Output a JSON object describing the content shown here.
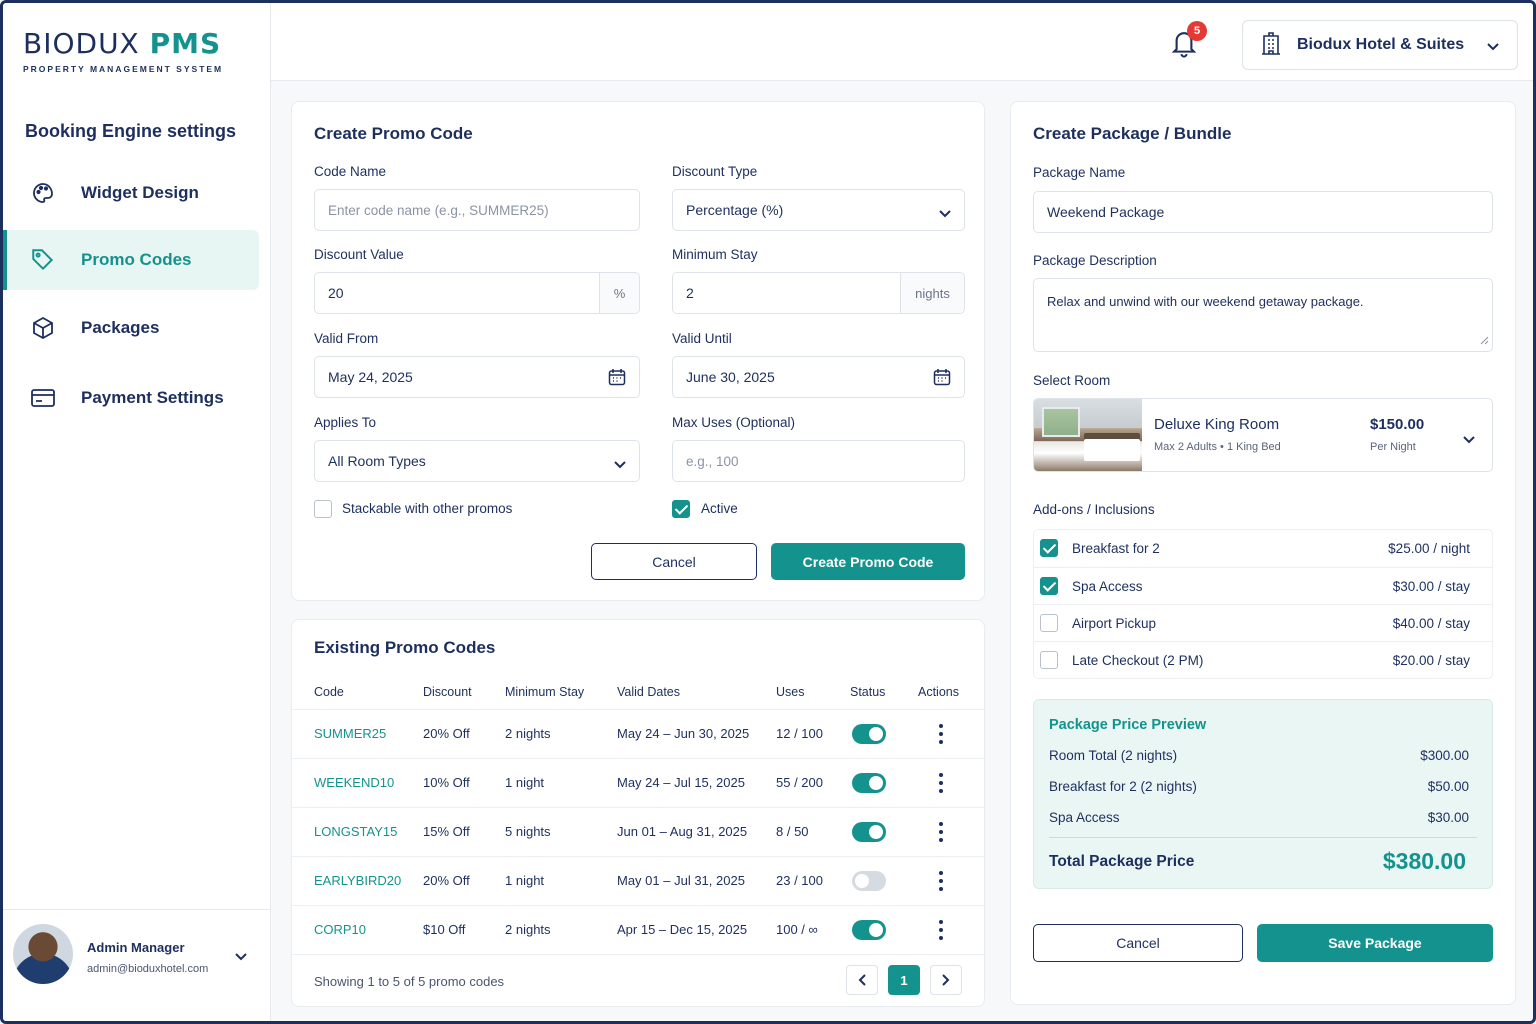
{
  "brand": {
    "name_part1": "BIODUX",
    "name_part2": "PMS",
    "tagline": "PROPERTY MANAGEMENT SYSTEM"
  },
  "sidebar": {
    "title": "Booking Engine settings",
    "items": [
      {
        "label": "Widget Design",
        "icon": "palette-icon"
      },
      {
        "label": "Promo Codes",
        "icon": "tag-icon",
        "active": true
      },
      {
        "label": "Packages",
        "icon": "box-icon"
      },
      {
        "label": "Payment Settings",
        "icon": "card-icon"
      }
    ],
    "user": {
      "name": "Admin Manager",
      "email": "admin@bioduxhotel.com"
    }
  },
  "topbar": {
    "notification_count": "5",
    "hotel_name": "Biodux Hotel & Suites"
  },
  "promo_form": {
    "title": "Create Promo Code",
    "code_name_label": "Code Name",
    "code_name_placeholder": "Enter code name (e.g., SUMMER25)",
    "discount_type_label": "Discount Type",
    "discount_type_value": "Percentage (%)",
    "discount_value_label": "Discount Value",
    "discount_value": "20",
    "discount_value_suffix": "%",
    "min_stay_label": "Minimum Stay",
    "min_stay_value": "2",
    "min_stay_suffix": "nights",
    "valid_from_label": "Valid From",
    "valid_from_value": "May 24, 2025",
    "valid_until_label": "Valid Until",
    "valid_until_value": "June 30, 2025",
    "applies_to_label": "Applies To",
    "applies_to_value": "All Room Types",
    "max_uses_label": "Max Uses (Optional)",
    "max_uses_placeholder": "e.g., 100",
    "stackable_label": "Stackable with other promos",
    "stackable_checked": false,
    "active_label": "Active",
    "active_checked": true,
    "cancel_label": "Cancel",
    "submit_label": "Create Promo Code"
  },
  "promo_table": {
    "title": "Existing Promo Codes",
    "columns": [
      "Code",
      "Discount",
      "Minimum Stay",
      "Valid Dates",
      "Uses",
      "Status",
      "Actions"
    ],
    "rows": [
      {
        "code": "SUMMER25",
        "discount": "20% Off",
        "min_stay": "2 nights",
        "dates": "May 24 – Jun 30, 2025",
        "uses": "12 / 100",
        "active": true
      },
      {
        "code": "WEEKEND10",
        "discount": "10% Off",
        "min_stay": "1 night",
        "dates": "May 24 – Jul 15, 2025",
        "uses": "55 / 200",
        "active": true
      },
      {
        "code": "LONGSTAY15",
        "discount": "15% Off",
        "min_stay": "5 nights",
        "dates": "Jun 01 – Aug 31, 2025",
        "uses": "8 / 50",
        "active": true
      },
      {
        "code": "EARLYBIRD20",
        "discount": "20% Off",
        "min_stay": "1 night",
        "dates": "May 01 – Jul 31, 2025",
        "uses": "23 / 100",
        "active": false
      },
      {
        "code": "CORP10",
        "discount": "$10 Off",
        "min_stay": "2 nights",
        "dates": "Apr 15 – Dec 15, 2025",
        "uses": "100 / ∞",
        "active": true
      }
    ],
    "footer_text": "Showing 1 to 5 of 5 promo codes",
    "current_page": "1"
  },
  "package_form": {
    "title": "Create Package / Bundle",
    "name_label": "Package Name",
    "name_value": "Weekend Package",
    "desc_label": "Package Description",
    "desc_value": "Relax and unwind with our weekend getaway package.",
    "room_label": "Select Room",
    "room": {
      "name": "Deluxe King Room",
      "guests": "Max 2 Adults",
      "bed": "1 King Bed",
      "price": "$150.00",
      "price_unit": "Per Night"
    },
    "addons_label": "Add-ons / Inclusions",
    "addons": [
      {
        "name": "Breakfast for 2",
        "price": "$25.00 / night",
        "checked": true
      },
      {
        "name": "Spa Access",
        "price": "$30.00 / stay",
        "checked": true
      },
      {
        "name": "Airport Pickup",
        "price": "$40.00 / stay",
        "checked": false
      },
      {
        "name": "Late Checkout (2 PM)",
        "price": "$20.00 / stay",
        "checked": false
      }
    ],
    "preview": {
      "title": "Package Price Preview",
      "lines": [
        {
          "label": "Room Total (2 nights)",
          "amount": "$300.00"
        },
        {
          "label": "Breakfast for 2 (2 nights)",
          "amount": "$50.00"
        },
        {
          "label": "Spa Access",
          "amount": "$30.00"
        }
      ],
      "total_label": "Total Package Price",
      "total_amount": "$380.00"
    },
    "cancel_label": "Cancel",
    "save_label": "Save Package"
  },
  "colors": {
    "accent": "#14938e",
    "navy": "#1d2f5e",
    "danger": "#e53935"
  }
}
